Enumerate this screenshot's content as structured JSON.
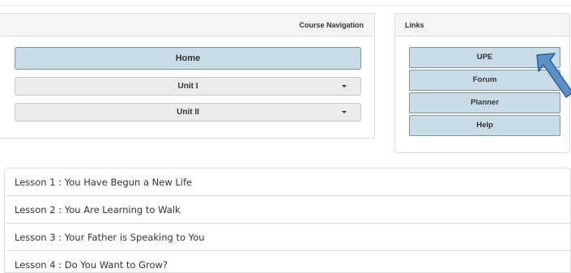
{
  "course_navigation": {
    "heading": "Course Navigation",
    "home_label": "Home",
    "units": [
      {
        "label": "Unit I"
      },
      {
        "label": "Unit II"
      }
    ]
  },
  "links": {
    "heading": "Links",
    "items": [
      {
        "label": "UPE"
      },
      {
        "label": "Forum"
      },
      {
        "label": "Planner"
      },
      {
        "label": "Help"
      }
    ]
  },
  "lessons": [
    {
      "label": "Lesson 1 : You Have Begun a New Life"
    },
    {
      "label": "Lesson 2 : You Are Learning to Walk"
    },
    {
      "label": "Lesson 3 : Your Father is Speaking to You"
    },
    {
      "label": "Lesson 4 : Do You Want to Grow?"
    }
  ],
  "colors": {
    "button_blue": "#c9dbe7",
    "button_border": "#7e93a3",
    "arrow_blue": "#5b8fc7"
  },
  "icons": {
    "dropdown": "caret-down-icon",
    "pointer": "pointer-arrow-icon"
  }
}
